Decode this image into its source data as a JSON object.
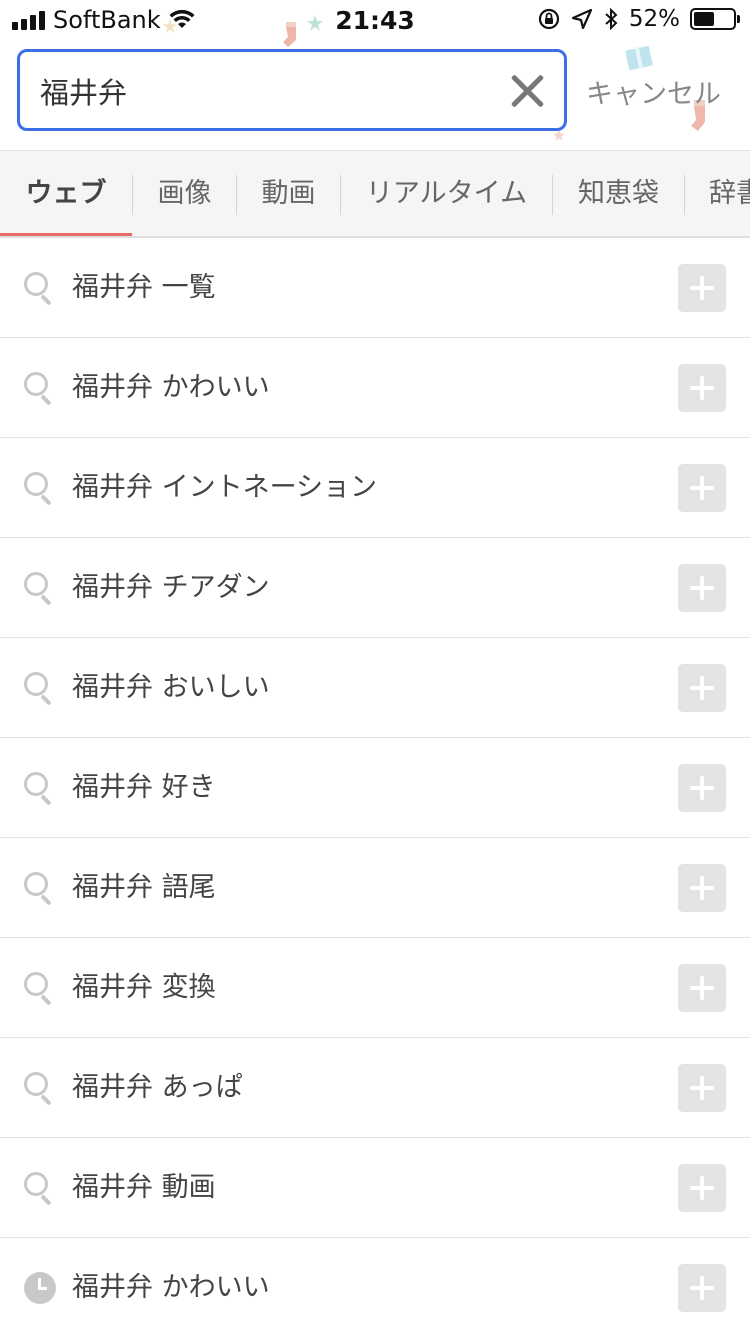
{
  "status_bar": {
    "carrier": "SoftBank",
    "time": "21:43",
    "battery_percent": "52%",
    "battery_level": 0.52,
    "icons": [
      "signal-icon",
      "wifi-icon",
      "orientation-lock-icon",
      "location-arrow-icon",
      "bluetooth-icon",
      "battery-icon"
    ]
  },
  "search": {
    "query": "福井弁",
    "cancel_label": "キャンセル",
    "accent_color": "#3c6ee6"
  },
  "tabs": [
    {
      "label": "ウェブ",
      "active": true
    },
    {
      "label": "画像"
    },
    {
      "label": "動画"
    },
    {
      "label": "リアルタイム"
    },
    {
      "label": "知恵袋"
    },
    {
      "label": "辞書"
    }
  ],
  "suggestions": [
    {
      "text": "福井弁 一覧",
      "icon": "search-icon"
    },
    {
      "text": "福井弁 かわいい",
      "icon": "search-icon"
    },
    {
      "text": "福井弁 イントネーション",
      "icon": "search-icon"
    },
    {
      "text": "福井弁 チアダン",
      "icon": "search-icon"
    },
    {
      "text": "福井弁 おいしい",
      "icon": "search-icon"
    },
    {
      "text": "福井弁 好き",
      "icon": "search-icon"
    },
    {
      "text": "福井弁 語尾",
      "icon": "search-icon"
    },
    {
      "text": "福井弁 変換",
      "icon": "search-icon"
    },
    {
      "text": "福井弁 あっぱ",
      "icon": "search-icon"
    },
    {
      "text": "福井弁 動画",
      "icon": "search-icon"
    },
    {
      "text": "福井弁 かわいい",
      "icon": "history-clock-icon"
    }
  ]
}
